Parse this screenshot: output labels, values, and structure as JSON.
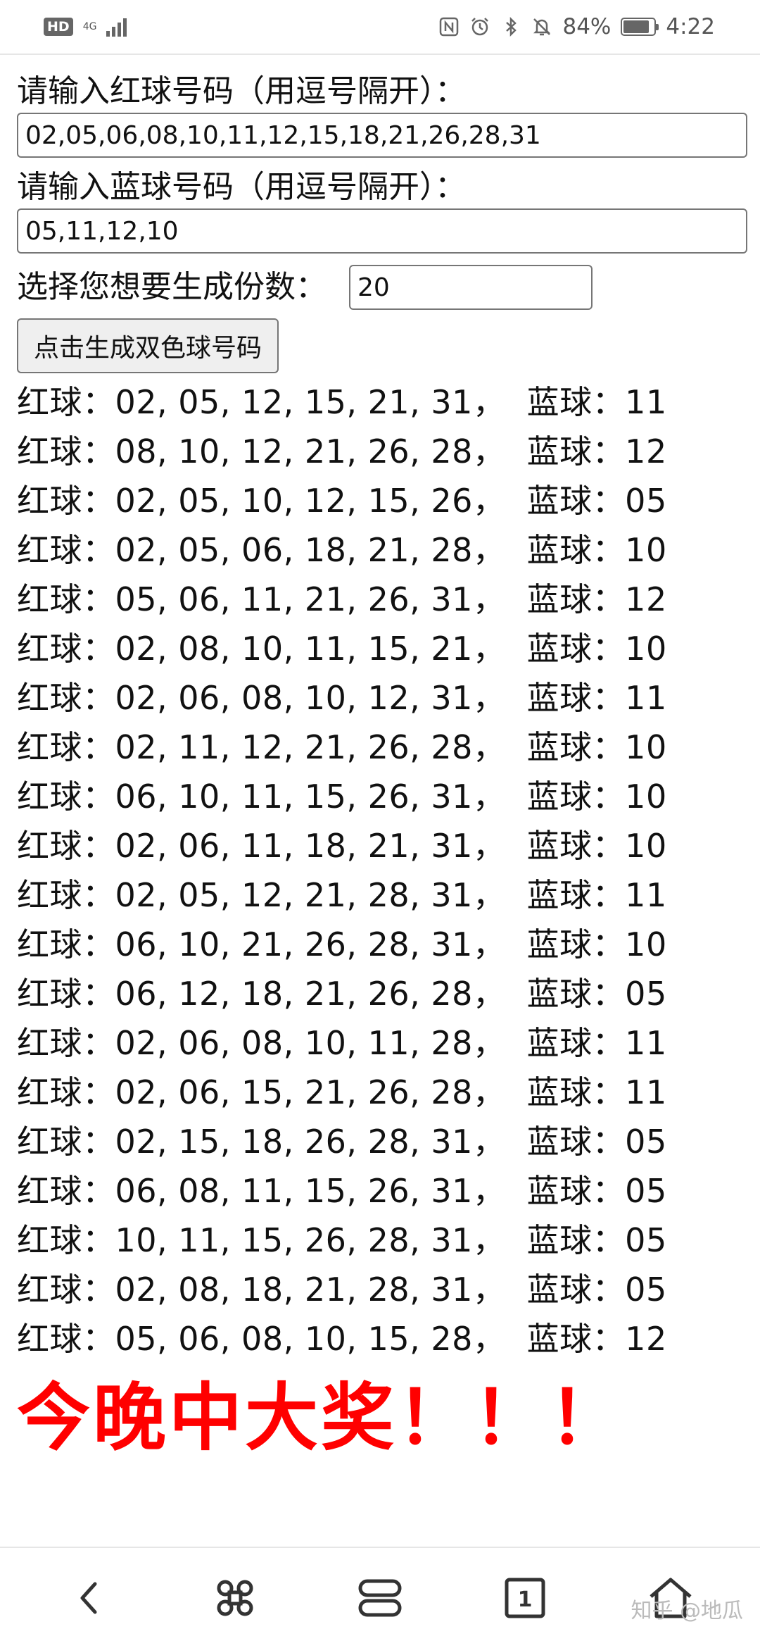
{
  "status_bar": {
    "hd": "HD",
    "network_gen": "4G",
    "battery_percent": "84%",
    "battery_level": 0.84,
    "time": "4:22",
    "icons": [
      "nfc-icon",
      "alarm-icon",
      "bluetooth-icon",
      "mute-icon"
    ]
  },
  "form": {
    "red_label": "请输入红球号码（用逗号隔开）：",
    "red_value": "02,05,06,08,10,11,12,15,18,21,26,28,31",
    "blue_label": "请输入蓝球号码（用逗号隔开）：",
    "blue_value": "05,11,12,10",
    "count_label": "选择您想要生成份数：",
    "count_value": "20",
    "generate_button": "点击生成双色球号码"
  },
  "results": [
    {
      "red": "02, 05, 12, 15, 21, 31",
      "blue": "11"
    },
    {
      "red": "08, 10, 12, 21, 26, 28",
      "blue": "12"
    },
    {
      "red": "02, 05, 10, 12, 15, 26",
      "blue": "05"
    },
    {
      "red": "02, 05, 06, 18, 21, 28",
      "blue": "10"
    },
    {
      "red": "05, 06, 11, 21, 26, 31",
      "blue": "12"
    },
    {
      "red": "02, 08, 10, 11, 15, 21",
      "blue": "10"
    },
    {
      "red": "02, 06, 08, 10, 12, 31",
      "blue": "11"
    },
    {
      "red": "02, 11, 12, 21, 26, 28",
      "blue": "10"
    },
    {
      "red": "06, 10, 11, 15, 26, 31",
      "blue": "10"
    },
    {
      "red": "02, 06, 11, 18, 21, 31",
      "blue": "10"
    },
    {
      "red": "02, 05, 12, 21, 28, 31",
      "blue": "11"
    },
    {
      "red": "06, 10, 21, 26, 28, 31",
      "blue": "10"
    },
    {
      "red": "06, 12, 18, 21, 26, 28",
      "blue": "05"
    },
    {
      "red": "02, 06, 08, 10, 11, 28",
      "blue": "11"
    },
    {
      "red": "02, 06, 15, 21, 26, 28",
      "blue": "11"
    },
    {
      "red": "02, 15, 18, 26, 28, 31",
      "blue": "05"
    },
    {
      "red": "06, 08, 11, 15, 26, 31",
      "blue": "05"
    },
    {
      "red": "10, 11, 15, 26, 28, 31",
      "blue": "05"
    },
    {
      "red": "02, 08, 18, 21, 28, 31",
      "blue": "05"
    },
    {
      "red": "05, 06, 08, 10, 15, 28",
      "blue": "12"
    }
  ],
  "result_labels": {
    "red_prefix": "红球：",
    "blue_prefix": "，  蓝球："
  },
  "banner": "今晚中大奖！！！",
  "watermark": "知乎 @地瓜",
  "nav": {
    "page_count": "1",
    "icons": [
      "back-icon",
      "shortcut-icon",
      "tabs-icon",
      "pages-icon",
      "home-icon"
    ]
  },
  "colors": {
    "banner": "#ff0000",
    "button_bg": "#efefef",
    "border": "#767676"
  }
}
